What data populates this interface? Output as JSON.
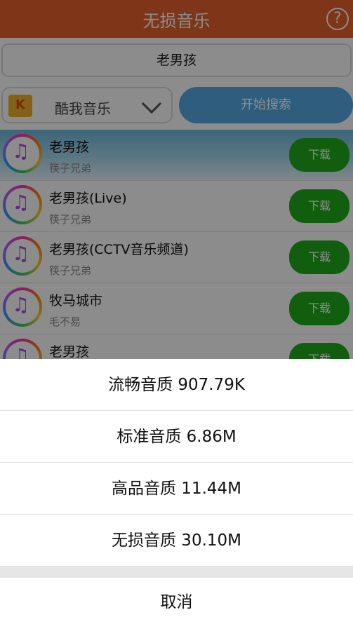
{
  "app": {
    "title": "无损音乐",
    "help_glyph": "?",
    "search_value": "老男孩",
    "source_label": "酷我音乐",
    "search_button": "开始搜索"
  },
  "results": [
    {
      "name": "老男孩",
      "artist": "筷子兄弟",
      "button": "下载"
    },
    {
      "name": "老男孩(Live)",
      "artist": "筷子兄弟",
      "button": "下载"
    },
    {
      "name": "老男孩(CCTV音乐频道)",
      "artist": "筷子兄弟",
      "button": "下载"
    },
    {
      "name": "牧马城市",
      "artist": "毛不易",
      "button": "下载"
    },
    {
      "name": "老男孩",
      "artist": "",
      "button": "下载"
    }
  ],
  "sheet": {
    "options": [
      "流畅音质 907.79K",
      "标准音质 6.86M",
      "高品音质 11.44M",
      "无损音质 30.10M"
    ],
    "cancel": "取消"
  },
  "colors": {
    "titlebar": "#e8612a",
    "search_button": "#55a9e6",
    "download_button": "#1fae1b"
  }
}
